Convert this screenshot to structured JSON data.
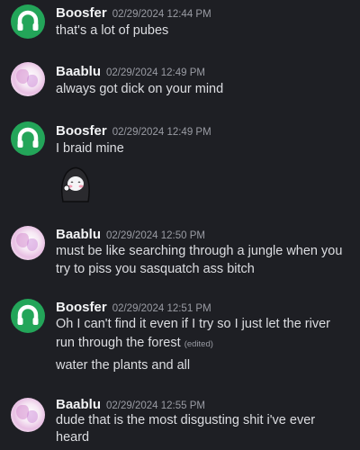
{
  "messages": [
    {
      "author": "Boosfer",
      "timestamp": "02/29/2024 12:44 PM",
      "avatar": "green-headphones-avatar",
      "lines": [
        "that's a lot of pubes"
      ]
    },
    {
      "author": "Baablu",
      "timestamp": "02/29/2024 12:49 PM",
      "avatar": "pink-anime-avatar",
      "lines": [
        "always got dick on your mind"
      ]
    },
    {
      "author": "Boosfer",
      "timestamp": "02/29/2024 12:49 PM",
      "avatar": "green-headphones-avatar",
      "lines": [
        "I braid mine"
      ],
      "sticker": "hooded-blushing-character-sticker"
    },
    {
      "author": "Baablu",
      "timestamp": "02/29/2024 12:50 PM",
      "avatar": "pink-anime-avatar",
      "lines": [
        "must be like searching through a jungle when you",
        "try to piss you sasquatch ass bitch"
      ]
    },
    {
      "author": "Boosfer",
      "timestamp": "02/29/2024 12:51 PM",
      "avatar": "green-headphones-avatar",
      "lines": [
        "Oh I can't find it even if I try so I just let the river",
        "run through the forest"
      ],
      "edited_label": "(edited)",
      "followup": "water the plants and all"
    },
    {
      "author": "Baablu",
      "timestamp": "02/29/2024 12:55 PM",
      "avatar": "pink-anime-avatar",
      "lines": [
        "dude that is the most disgusting shit i've ever",
        "heard"
      ]
    }
  ],
  "colors": {
    "background": "#1e1f24",
    "username": "#f2f3f5",
    "text": "#dcdde1",
    "muted": "#9a9ca4",
    "boosfer_avatar": "#23a559"
  }
}
